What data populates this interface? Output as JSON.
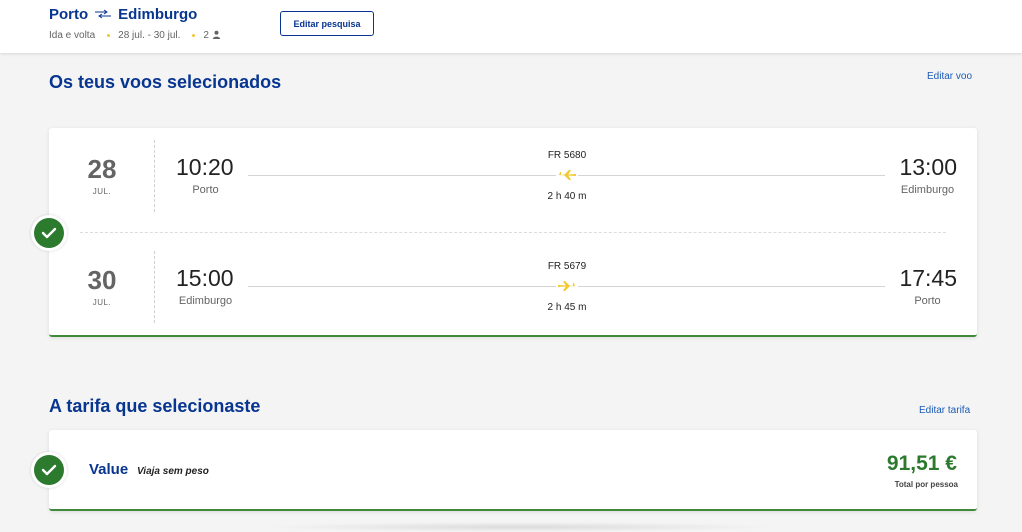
{
  "header": {
    "origin": "Porto",
    "swap_icon": "↔",
    "destination": "Edimburgo",
    "trip_type": "Ida e volta",
    "dates": "28 jul. - 30 jul.",
    "passengers": "2",
    "edit_search_label": "Editar pesquisa"
  },
  "flights_section": {
    "title": "Os teus voos selecionados",
    "edit_label": "Editar voo",
    "flights": [
      {
        "day": "28",
        "month": "JUL.",
        "dep_time": "10:20",
        "dep_city": "Porto",
        "flight_number": "FR 5680",
        "duration": "2 h 40 m",
        "arr_time": "13:00",
        "arr_city": "Edimburgo"
      },
      {
        "day": "30",
        "month": "JUL.",
        "dep_time": "15:00",
        "dep_city": "Edimburgo",
        "flight_number": "FR 5679",
        "duration": "2 h 45 m",
        "arr_time": "17:45",
        "arr_city": "Porto"
      }
    ]
  },
  "fare_section": {
    "title": "A tarifa que selecionaste",
    "edit_label": "Editar tarifa",
    "fare_name": "Value",
    "fare_description": "Viaja sem peso",
    "price": "91,51 €",
    "price_label": "Total por pessoa"
  },
  "colors": {
    "brand_blue": "#073590",
    "link_blue": "#1a5bb6",
    "success_green": "#2c7a2e",
    "accent_yellow": "#f1c933"
  },
  "icons": {
    "swap": "swap-arrows-icon",
    "passenger": "person-icon",
    "plane": "plane-icon",
    "check": "check-icon"
  }
}
